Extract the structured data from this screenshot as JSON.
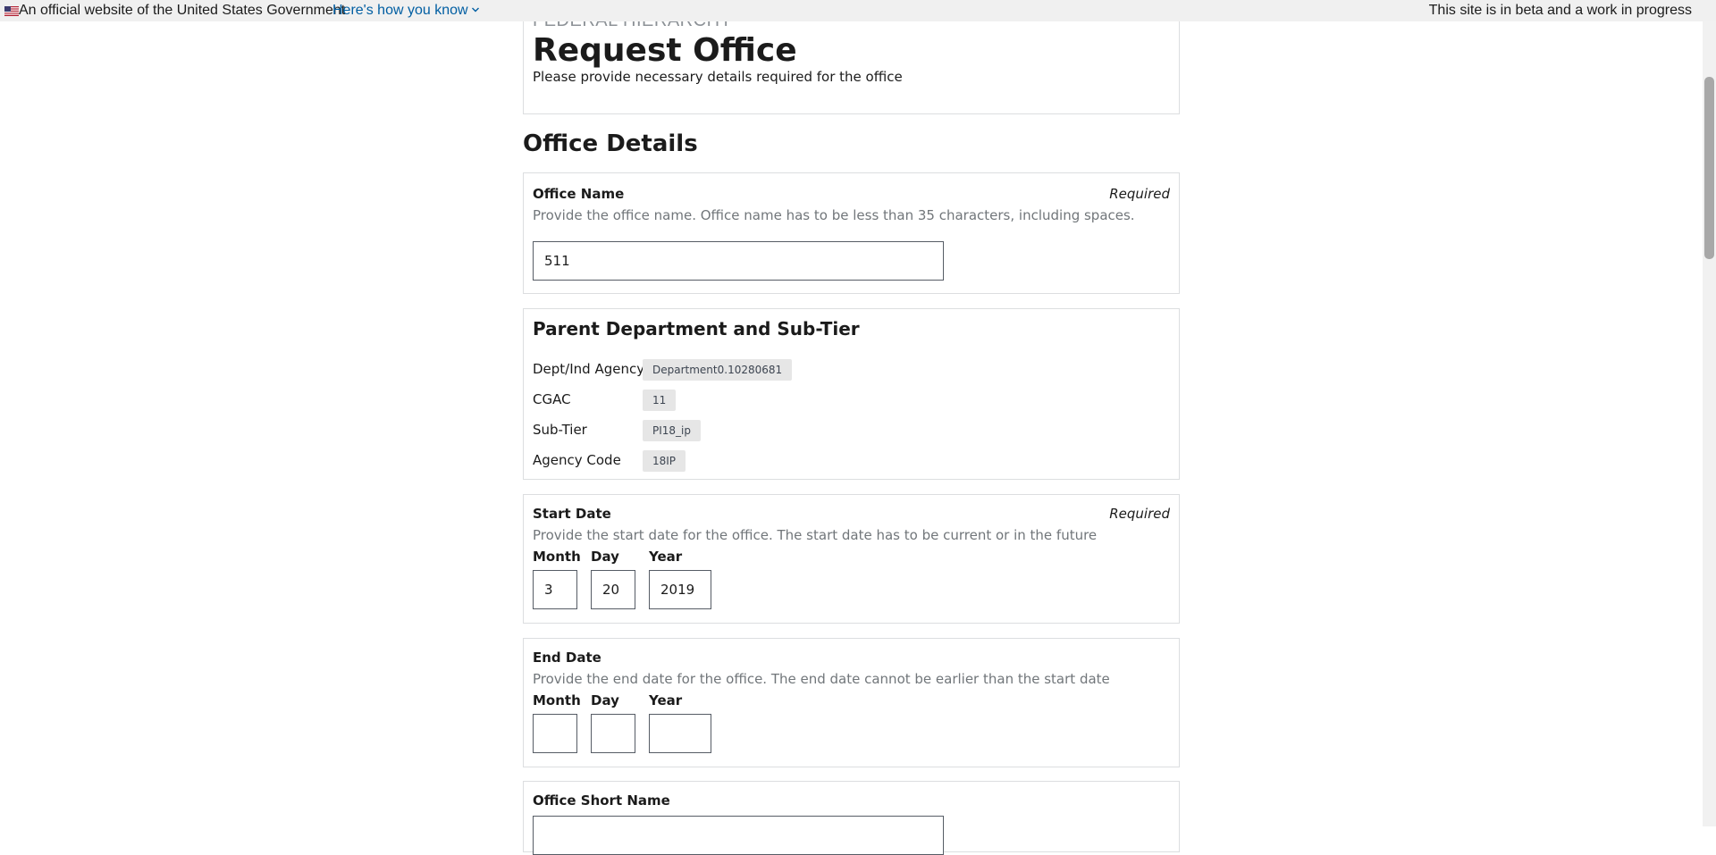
{
  "banner": {
    "official_text": "An official website of the United States Government",
    "how_you_know": "Here's how you know",
    "beta_text": "This site is in beta and a work in progress"
  },
  "header": {
    "eyebrow": "FEDERAL HIERARCHY",
    "title": "Request Office",
    "subtitle": "Please provide necessary details required for the office"
  },
  "section_title": "Office Details",
  "office_name": {
    "label": "Office Name",
    "required": "Required",
    "hint": "Provide the office name. Office name has to be less than 35 characters, including spaces.",
    "value": "511"
  },
  "parent_dept": {
    "heading": "Parent Department and Sub-Tier",
    "rows": [
      {
        "key": "Dept/Ind Agency",
        "value": "Department0.10280681"
      },
      {
        "key": "CGAC",
        "value": "11"
      },
      {
        "key": "Sub-Tier",
        "value": "PI18_ip"
      },
      {
        "key": "Agency Code",
        "value": "18IP"
      }
    ]
  },
  "start_date": {
    "label": "Start Date",
    "required": "Required",
    "hint": "Provide the start date for the office. The start date has to be current or in the future",
    "month_label": "Month",
    "day_label": "Day",
    "year_label": "Year",
    "month": "3",
    "day": "20",
    "year": "2019"
  },
  "end_date": {
    "label": "End Date",
    "hint": "Provide the end date for the office. The end date cannot be earlier than the start date",
    "month_label": "Month",
    "day_label": "Day",
    "year_label": "Year",
    "month": "",
    "day": "",
    "year": ""
  },
  "short_name": {
    "label": "Office Short Name",
    "value": ""
  },
  "colors": {
    "link": "#005ea2",
    "banner_bg": "#f0f0f0",
    "hint_text": "#71767a",
    "tag_bg": "#e6e6e6",
    "border": "#dcdee0"
  }
}
